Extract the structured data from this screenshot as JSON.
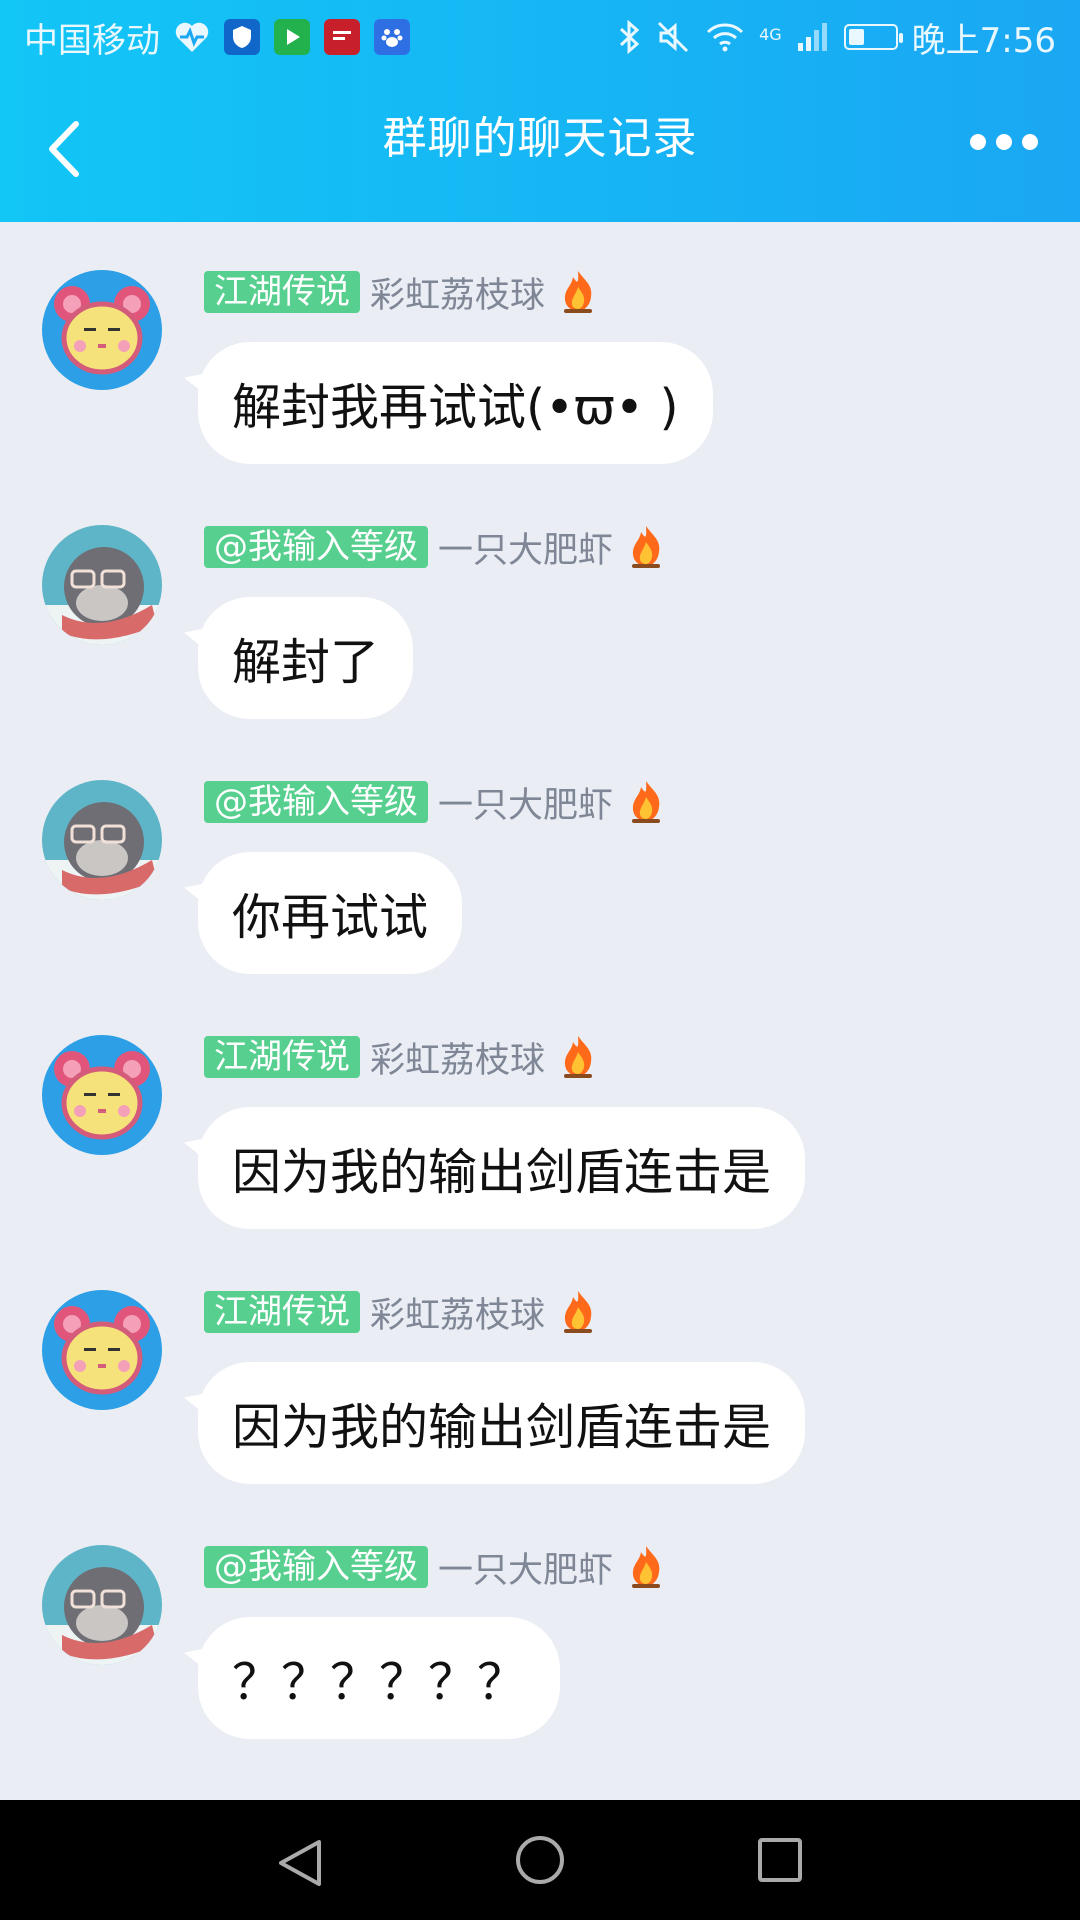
{
  "status": {
    "carrier": "中国移动",
    "network": "4G",
    "time": "晚上7:56",
    "battery_level": 0.35,
    "icons": [
      "heart-pulse-icon",
      "shield-icon",
      "video-play-icon",
      "netease-icon",
      "baidu-icon",
      "bluetooth-icon",
      "mute-icon",
      "wifi-icon",
      "signal-icon",
      "battery-icon"
    ]
  },
  "header": {
    "title": "群聊的聊天记录",
    "back_icon": "chevron-left-icon",
    "more_icon": "more-dots-icon"
  },
  "messages": [
    {
      "tag": "江湖传说",
      "nickname": "彩虹荔枝球",
      "avatar": "pink-bear-avatar",
      "text": "解封我再试试(•ϖ• )"
    },
    {
      "tag": "@我输入等级",
      "nickname": "一只大肥虾",
      "avatar": "gray-seal-avatar",
      "text": "解封了"
    },
    {
      "tag": "@我输入等级",
      "nickname": "一只大肥虾",
      "avatar": "gray-seal-avatar",
      "text": "你再试试"
    },
    {
      "tag": "江湖传说",
      "nickname": "彩虹荔枝球",
      "avatar": "pink-bear-avatar",
      "text": "因为我的输出剑盾连击是"
    },
    {
      "tag": "江湖传说",
      "nickname": "彩虹荔枝球",
      "avatar": "pink-bear-avatar",
      "text": "因为我的输出剑盾连击是"
    },
    {
      "tag": "@我输入等级",
      "nickname": "一只大肥虾",
      "avatar": "gray-seal-avatar",
      "text": "？？？？？？"
    }
  ],
  "colors": {
    "header_start": "#12c6f6",
    "header_end": "#1aa7f3",
    "tag_green": "#57cf8f",
    "background": "#eaedf4"
  }
}
